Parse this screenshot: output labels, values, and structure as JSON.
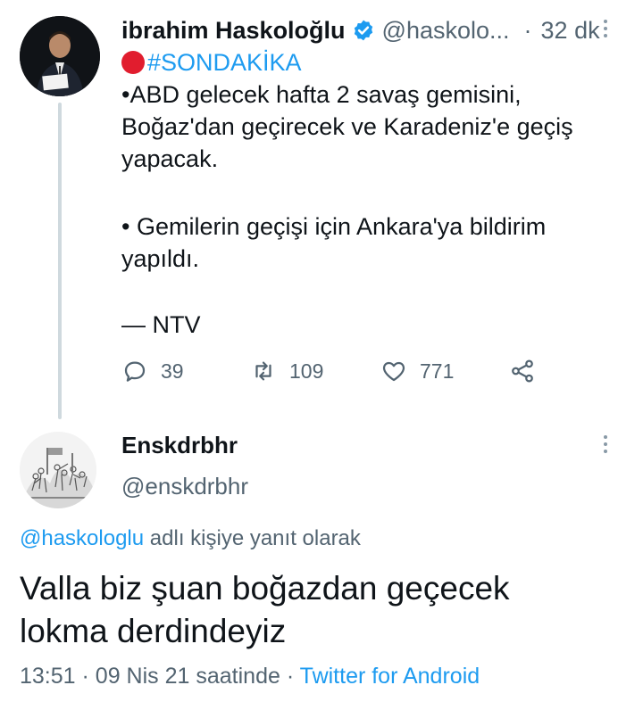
{
  "tweet": {
    "author_name": "ibrahim Haskoloğlu",
    "author_handle": "@haskolo...",
    "separator": "·",
    "time_ago": "32 dk",
    "hashtag": "#SONDAKİKA",
    "lines": [
      "•ABD gelecek hafta 2 savaş gemisini,",
      "Boğaz'dan geçirecek ve Karadeniz'e geçiş",
      "yapacak.",
      "• Gemilerin geçişi için Ankara'ya bildirim",
      "yapıldı.",
      "— NTV"
    ],
    "stats": {
      "replies": "39",
      "retweets": "109",
      "likes": "771"
    },
    "icons": {
      "verified": "verified-badge-icon",
      "breaking": "red-circle-icon",
      "reply": "reply-icon",
      "retweet": "retweet-icon",
      "like": "heart-icon",
      "share": "share-icon",
      "more": "more-vertical-icon"
    }
  },
  "reply": {
    "author_name": "Enskdrbhr",
    "author_handle": "@enskdrbhr",
    "replying_to_mention": "@haskologlu",
    "replying_to_suffix": " adlı kişiye yanıt olarak",
    "body_lines": [
      "Valla biz şuan boğazdan geçecek",
      "lokma derdindeyiz"
    ],
    "time": "13:51",
    "date": "09 Nis 21 saatinde",
    "separator": "·",
    "source": "Twitter for Android"
  },
  "colors": {
    "accent": "#1d9bf0",
    "text_primary": "#0f1419",
    "text_secondary": "#536471",
    "breaking_red": "#e11d2e",
    "thread_line": "#cfd9de"
  }
}
